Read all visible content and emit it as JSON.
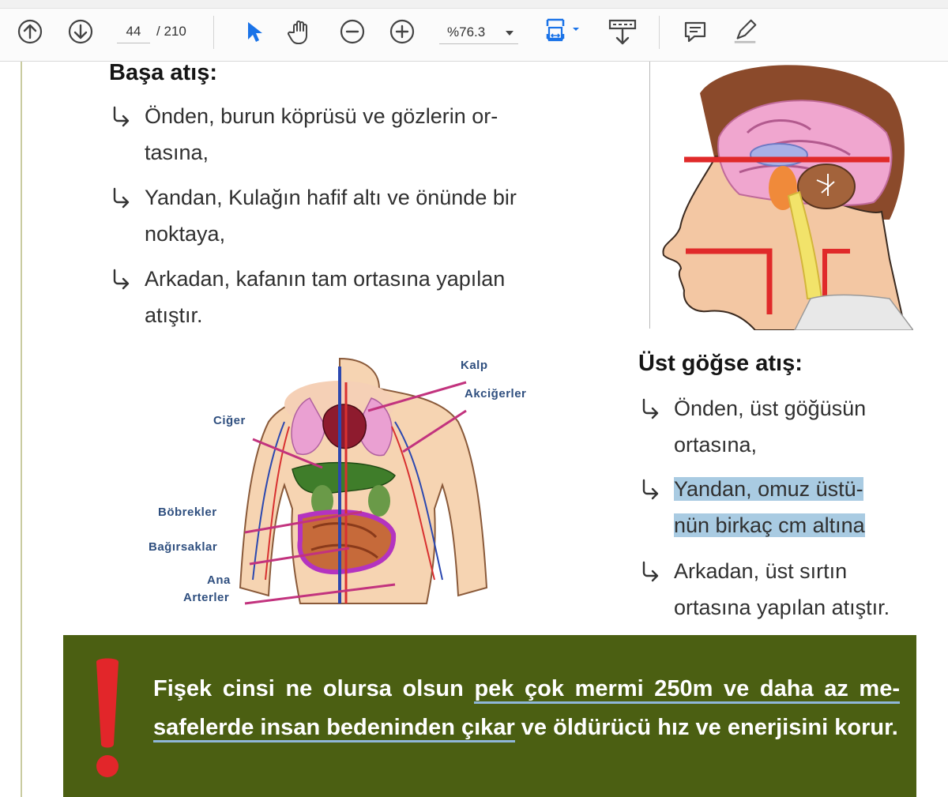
{
  "toolbar": {
    "page_current": "44",
    "page_total": "/ 210",
    "zoom": "%76.3",
    "icons": [
      "prev-page-icon",
      "next-page-icon",
      "select-arrow-icon",
      "hand-icon",
      "zoom-out-icon",
      "zoom-in-icon",
      "fit-page-icon",
      "scroll-mode-icon",
      "comment-icon",
      "pen-icon"
    ]
  },
  "section1": {
    "heading": "Başa atış:",
    "bullets": [
      {
        "line1": "Önden, burun köprüsü ve gözlerin or-",
        "line2": "tasına,"
      },
      {
        "line1": "Yandan, Kulağın hafif altı ve önünde bir",
        "line2": "noktaya,"
      },
      {
        "line1": "Arkadan, kafanın tam ortasına yapılan",
        "line2": "atıştır."
      }
    ]
  },
  "section2": {
    "heading": "Üst göğse atış:",
    "bullets": [
      {
        "line1": "Önden, üst göğüsün",
        "line2": "ortasına,"
      },
      {
        "line1": "Yandan, omuz üstü-",
        "line2": "nün birkaç cm altına"
      },
      {
        "line1": "Arkadan, üst sırtın",
        "line2": "ortasına yapılan atıştır."
      }
    ]
  },
  "organs": {
    "kalp": "Kalp",
    "akcigerler": "Akciğerler",
    "ciger": "Ciğer",
    "bobrekler": "Böbrekler",
    "bagirsaklar": "Bağırsaklar",
    "ana": "Ana",
    "arterler": "Arterler"
  },
  "warning": {
    "part1": "Fişek cinsi ne olursa olsun ",
    "underlined": "pek çok mermi 250m ve daha az me-safelerde insan bedeninden çıkar",
    "part2": " ve öldürücü hız ve enerjisini korur.",
    "mark": "!"
  },
  "colors": {
    "warning_bg": "#4b5f12",
    "highlight": "#a9cbe2",
    "toolbar_accent": "#1a73e8"
  }
}
